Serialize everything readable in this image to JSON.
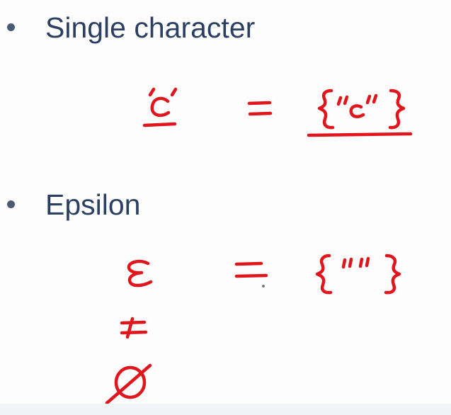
{
  "bullets": [
    {
      "text": "Single character"
    },
    {
      "text": "Epsilon"
    }
  ],
  "ink": {
    "color": "#e0161c",
    "text_color": "#2b3f63",
    "bullet_color": "#4a5a73"
  }
}
